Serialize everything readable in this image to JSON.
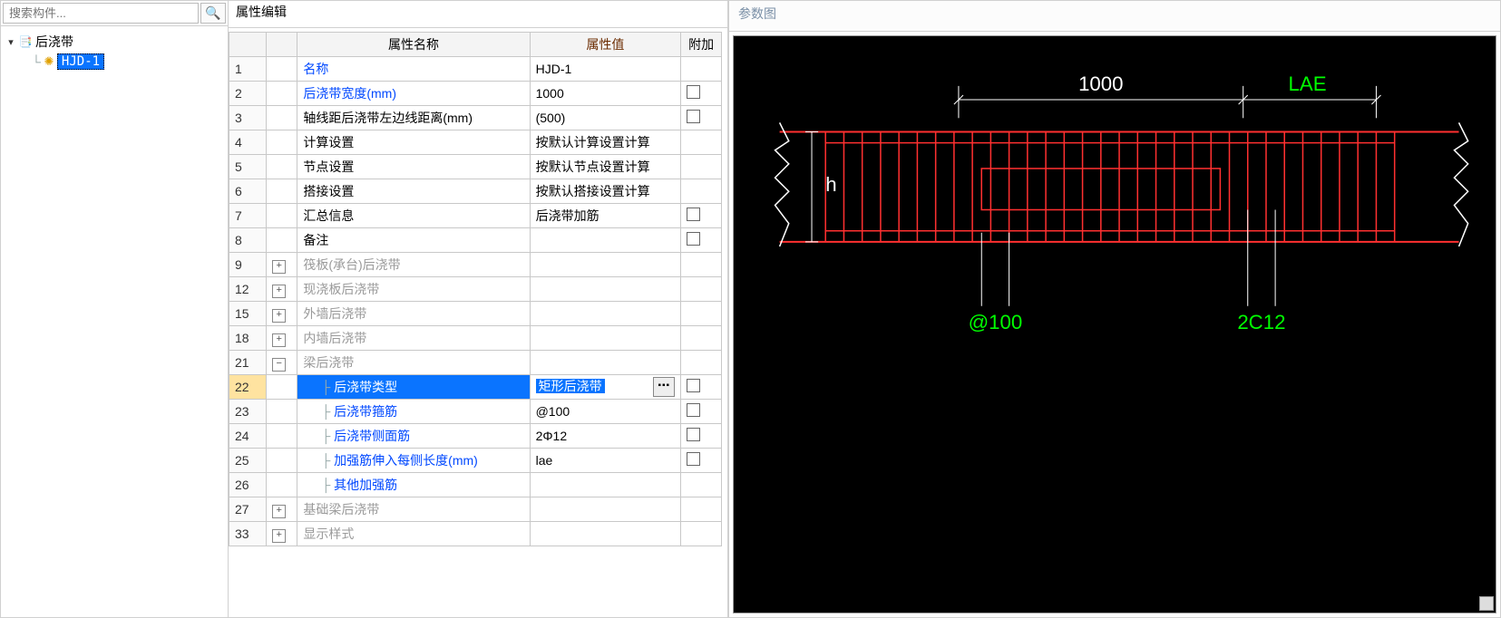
{
  "search": {
    "placeholder": "搜索构件..."
  },
  "tree": {
    "root_label": "后浇带",
    "child_label": "HJD-1"
  },
  "prop_editor": {
    "title": "属性编辑",
    "headers": {
      "name": "属性名称",
      "value": "属性值",
      "extra": "附加"
    },
    "rows": [
      {
        "n": "1",
        "name": "名称",
        "value": "HJD-1",
        "blue": true,
        "chk": false
      },
      {
        "n": "2",
        "name": "后浇带宽度(mm)",
        "value": "1000",
        "blue": true,
        "chk": true
      },
      {
        "n": "3",
        "name": "轴线距后浇带左边线距离(mm)",
        "value": "(500)",
        "blue": false,
        "chk": true
      },
      {
        "n": "4",
        "name": "计算设置",
        "value": "按默认计算设置计算",
        "blue": false,
        "chk": false
      },
      {
        "n": "5",
        "name": "节点设置",
        "value": "按默认节点设置计算",
        "blue": false,
        "chk": false
      },
      {
        "n": "6",
        "name": "搭接设置",
        "value": "按默认搭接设置计算",
        "blue": false,
        "chk": false
      },
      {
        "n": "7",
        "name": "汇总信息",
        "value": "后浇带加筋",
        "blue": false,
        "chk": true
      },
      {
        "n": "8",
        "name": "备注",
        "value": "",
        "blue": false,
        "chk": true
      }
    ],
    "groups": [
      {
        "n": "9",
        "exp": "+",
        "name": "筏板(承台)后浇带"
      },
      {
        "n": "12",
        "exp": "+",
        "name": "现浇板后浇带"
      },
      {
        "n": "15",
        "exp": "+",
        "name": "外墙后浇带"
      },
      {
        "n": "18",
        "exp": "+",
        "name": "内墙后浇带"
      }
    ],
    "open_group": {
      "n": "21",
      "exp": "−",
      "name": "梁后浇带"
    },
    "open_rows": [
      {
        "n": "22",
        "name": "后浇带类型",
        "value": "矩形后浇带",
        "blue": true,
        "sel": true,
        "chk": true
      },
      {
        "n": "23",
        "name": "后浇带箍筋",
        "value": "@100",
        "blue": true,
        "sel": false,
        "chk": true
      },
      {
        "n": "24",
        "name": "后浇带侧面筋",
        "value": "2Φ12",
        "blue": true,
        "sel": false,
        "chk": true
      },
      {
        "n": "25",
        "name": "加强筋伸入每侧长度(mm)",
        "value": "lae",
        "blue": true,
        "sel": false,
        "chk": true
      },
      {
        "n": "26",
        "name": "其他加强筋",
        "value": "",
        "blue": true,
        "sel": false,
        "chk": false
      }
    ],
    "tail_groups": [
      {
        "n": "27",
        "exp": "+",
        "name": "基础梁后浇带"
      },
      {
        "n": "33",
        "exp": "+",
        "name": "显示样式"
      }
    ]
  },
  "diagram": {
    "title": "参数图",
    "labels": {
      "width": "1000",
      "lae": "LAE",
      "h": "h",
      "spacing": "@100",
      "side": "2C12"
    }
  }
}
